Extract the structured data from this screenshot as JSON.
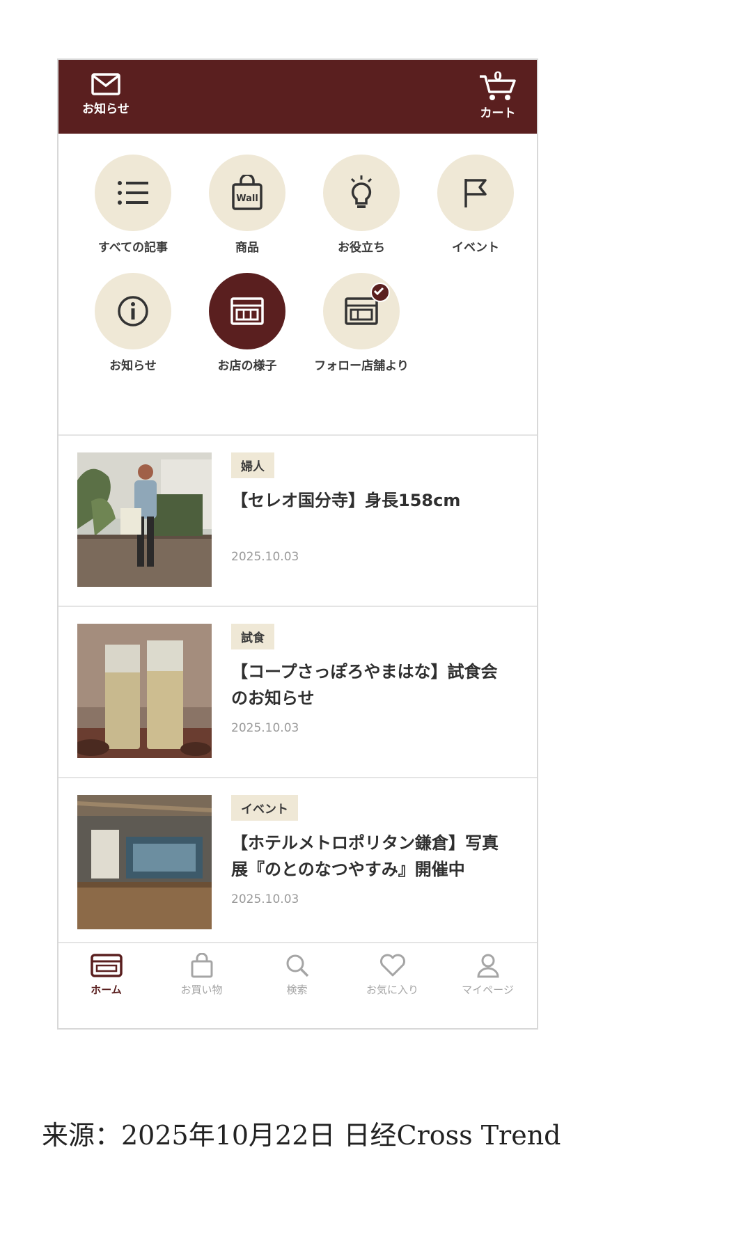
{
  "header": {
    "notice_label": "お知らせ",
    "cart_label": "カート",
    "cart_count": "0"
  },
  "categories": [
    {
      "label": "すべての記事",
      "icon": "list-icon"
    },
    {
      "label": "商品",
      "icon": "shopping-bag-icon"
    },
    {
      "label": "お役立ち",
      "icon": "lightbulb-icon"
    },
    {
      "label": "イベント",
      "icon": "flag-icon"
    },
    {
      "label": "お知らせ",
      "icon": "info-icon"
    },
    {
      "label": "お店の様子",
      "icon": "store-icon"
    },
    {
      "label": "フォロー店舗より",
      "icon": "store-check-icon"
    }
  ],
  "articles": [
    {
      "tag": "婦人",
      "title": "【セレオ国分寺】身長158cm",
      "date": "2025.10.03"
    },
    {
      "tag": "試食",
      "title": "【コープさっぽろやまはな】試食会のお知らせ",
      "date": "2025.10.03"
    },
    {
      "tag": "イベント",
      "title": "【ホテルメトロポリタン鎌倉】写真展『のとのなつやすみ』開催中",
      "date": "2025.10.03"
    }
  ],
  "tabs": [
    {
      "label": "ホーム",
      "icon": "home-card-icon"
    },
    {
      "label": "お買い物",
      "icon": "shopping-bag-icon"
    },
    {
      "label": "検索",
      "icon": "search-icon"
    },
    {
      "label": "お気に入り",
      "icon": "heart-icon"
    },
    {
      "label": "マイページ",
      "icon": "user-icon"
    }
  ],
  "caption": "来源：2025年10月22日 日经Cross Trend",
  "colors": {
    "brand": "#5a1f1f",
    "icon_bg": "#efe8d6"
  }
}
